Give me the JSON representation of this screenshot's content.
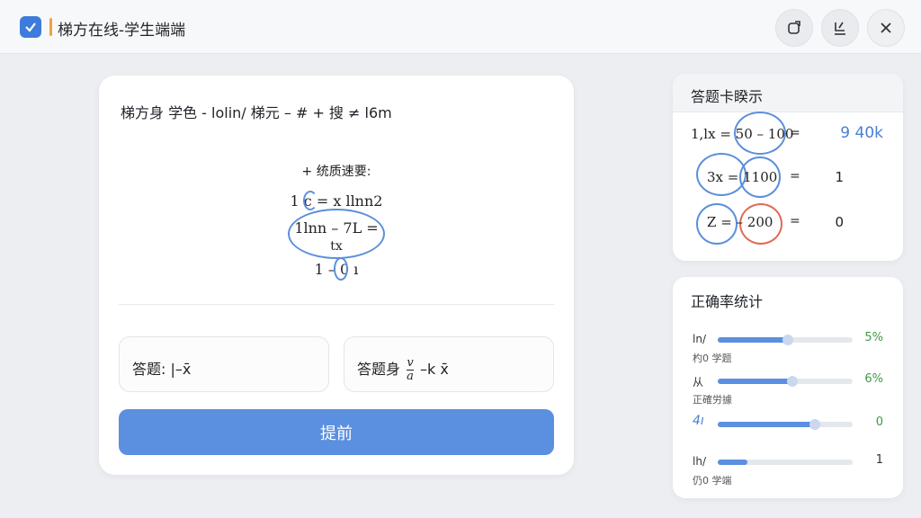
{
  "titlebar": {
    "title": "梯方在线-学生端端",
    "check_icon": "checkbox-icon",
    "buttons": [
      "export-icon",
      "pin-icon",
      "close-icon"
    ]
  },
  "question": {
    "heading": "梯方身 学色 - lolin/ 梯元 – # + 搜 ≠ l6m",
    "sub": "+ 统质速要:",
    "line1": "1 c = x llnn2",
    "line2": "1lnn – 7L =",
    "line3": "tx",
    "line4": "1 – 0 ı",
    "answer1_label": "答题:",
    "answer1_value": "|–x̄",
    "answer2_label": "答题身",
    "answer2_num": "v",
    "answer2_den": "a",
    "answer2_value": "–k x̄",
    "submit_label": "提前"
  },
  "answer_card": {
    "title": "答题卡睽示",
    "rows": [
      {
        "expr": "1,lx = 50 – 100",
        "eq": "=",
        "value": "9 40k"
      },
      {
        "expr": "3x = 1100",
        "eq": "=",
        "value": "1"
      },
      {
        "expr": "Z = – 200",
        "eq": "=",
        "value": "0"
      }
    ]
  },
  "accuracy": {
    "title": "正确率统计",
    "rows": [
      {
        "label": "ln/",
        "sub": "杓0 学题",
        "value": "5%",
        "fraction": 0.52
      },
      {
        "label": "从",
        "sub": "正確労據",
        "value": "6%",
        "fraction": 0.55
      },
      {
        "label": "4ı",
        "sub": "",
        "value": "0",
        "fraction": 0.72
      },
      {
        "label": "lh/",
        "sub": "仍0 学端",
        "value": "1",
        "fraction": 0.22
      }
    ]
  },
  "colors": {
    "accent": "#5b8fdf",
    "success": "#3f9a45",
    "alert": "#e06a55"
  }
}
